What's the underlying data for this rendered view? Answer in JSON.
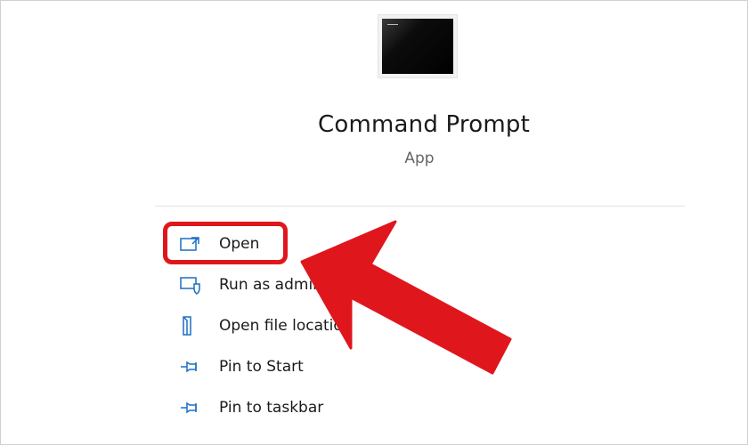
{
  "app": {
    "title": "Command Prompt",
    "subtitle": "App",
    "icon": "command-prompt-icon"
  },
  "menu": {
    "items": [
      {
        "label": "Open",
        "icon": "open-window-icon"
      },
      {
        "label": "Run as administrator",
        "icon": "shield-admin-icon"
      },
      {
        "label": "Open file location",
        "icon": "folder-icon"
      },
      {
        "label": "Pin to Start",
        "icon": "pin-icon"
      },
      {
        "label": "Pin to taskbar",
        "icon": "pin-icon"
      }
    ]
  },
  "annotation": {
    "highlighted_item": "Open",
    "color": "#e0161d"
  },
  "colors": {
    "icon_blue": "#1a6fc2",
    "text": "#1a1a1a",
    "subtext": "#666666"
  }
}
